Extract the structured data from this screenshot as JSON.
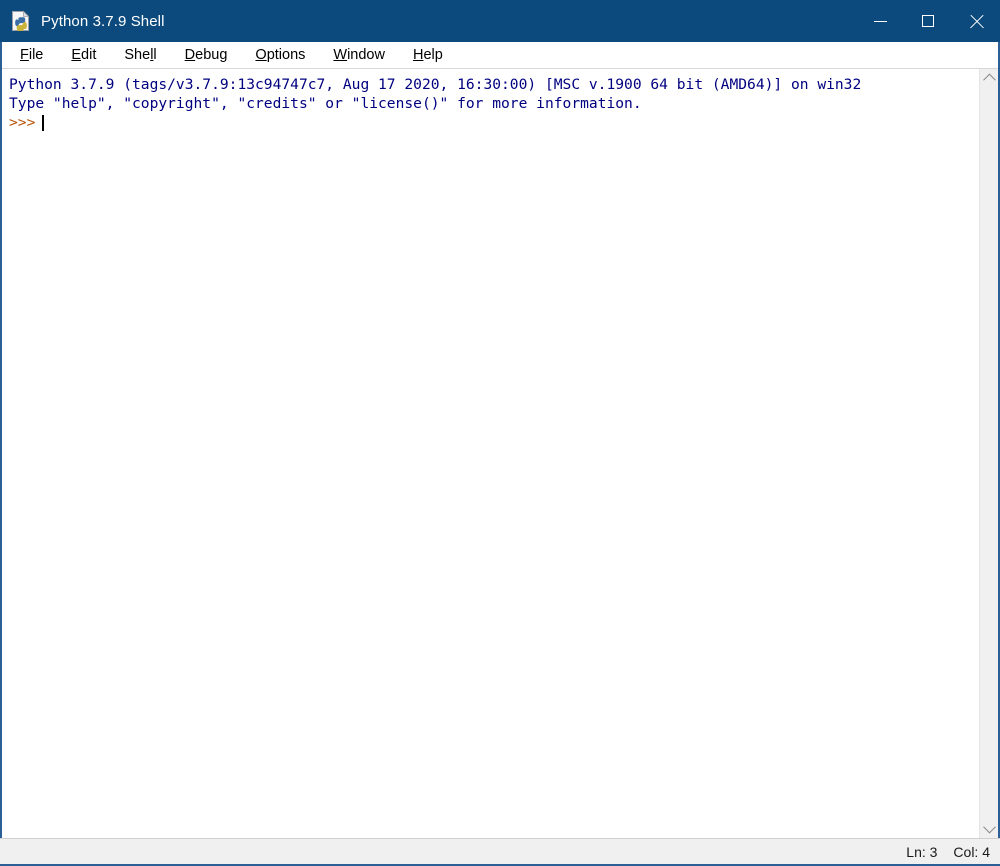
{
  "window": {
    "title": "Python 3.7.9 Shell",
    "icon": "python-file-icon",
    "titlebar_color": "#0c4a7d",
    "border_color": "#2b5f96",
    "controls": {
      "minimize_label": "Minimize",
      "maximize_label": "Maximize",
      "close_label": "Close"
    }
  },
  "menubar": {
    "items": [
      {
        "label": "File",
        "mnemonic": "F",
        "rest": "ile"
      },
      {
        "label": "Edit",
        "mnemonic": "E",
        "rest": "dit"
      },
      {
        "label": "Shell",
        "mnemonic": "l",
        "pre": "She",
        "rest": "l"
      },
      {
        "label": "Debug",
        "mnemonic": "D",
        "rest": "ebug"
      },
      {
        "label": "Options",
        "mnemonic": "O",
        "rest": "ptions"
      },
      {
        "label": "Window",
        "mnemonic": "W",
        "rest": "indow"
      },
      {
        "label": "Help",
        "mnemonic": "H",
        "rest": "elp"
      }
    ]
  },
  "shell": {
    "banner_line_1": "Python 3.7.9 (tags/v3.7.9:13c94747c7, Aug 17 2020, 16:30:00) [MSC v.1900 64 bit (AMD64)] on win32",
    "banner_line_2": "Type \"help\", \"copyright\", \"credits\" or \"license()\" for more information.",
    "prompt": ">>>",
    "input_value": "",
    "text_color": "#000080",
    "prompt_color": "#b8530a",
    "background": "#ffffff"
  },
  "scrollbar": {
    "up_arrow": "chevron-up",
    "down_arrow": "chevron-down",
    "track_color": "#f0f0f0"
  },
  "statusbar": {
    "line_label": "Ln: 3",
    "col_label": "Col: 4",
    "background": "#f0f0f0"
  }
}
